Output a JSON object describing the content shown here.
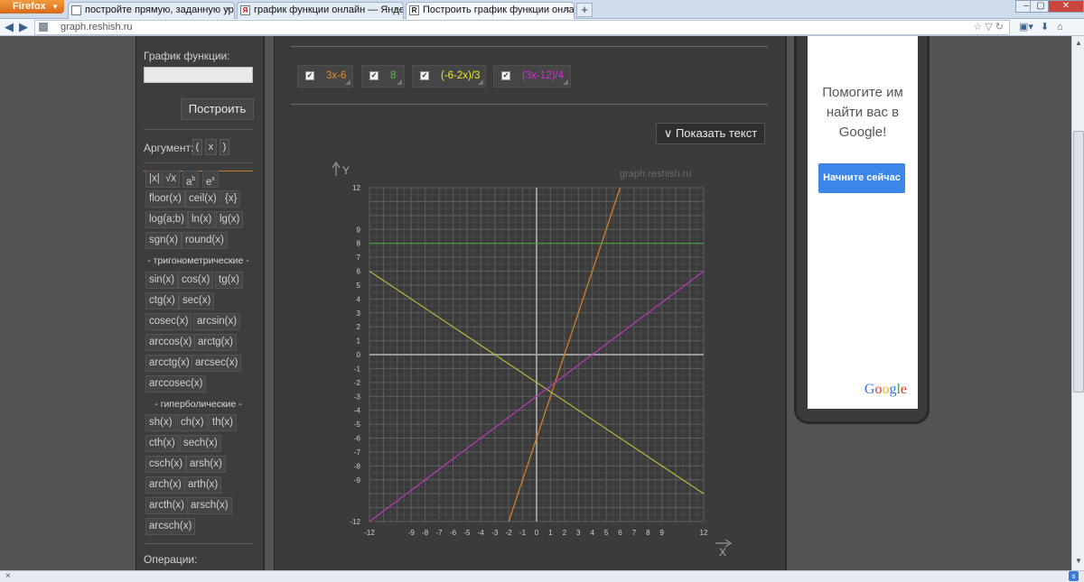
{
  "browser": {
    "app_button": "Firefox",
    "tabs": [
      {
        "label": "постройте прямую, заданную урав...",
        "icon": "page-icon"
      },
      {
        "label": "график функции онлайн — Яндекс: ...",
        "icon": "yandex-icon"
      },
      {
        "label": "Построить график функции онлайн",
        "icon": "reshish-icon"
      }
    ],
    "url": "graph.reshish.ru"
  },
  "left_panel": {
    "function_label": "График функции:",
    "function_input_value": "",
    "build_button": "Построить",
    "argument_label": "Аргумент:",
    "argument_buttons": [
      "(",
      "x",
      ")"
    ],
    "basic_buttons": [
      "|x|",
      "√x",
      "a",
      "e",
      "floor(x)",
      "ceil(x)",
      "{x}",
      "log(a;b)",
      "ln(x)",
      "lg(x)",
      "sgn(x)",
      "round(x)"
    ],
    "basic_sup": [
      "b",
      "x"
    ],
    "trig_header": "- тригонометрические -",
    "trig_buttons": [
      "sin(x)",
      "cos(x)",
      "tg(x)",
      "ctg(x)",
      "sec(x)",
      "cosec(x)",
      "arcsin(x)",
      "arccos(x)",
      "arctg(x)",
      "arcctg(x)",
      "arcsec(x)",
      "arccosec(x)"
    ],
    "hyper_header": "- гиперболические -",
    "hyper_buttons": [
      "sh(x)",
      "ch(x)",
      "th(x)",
      "cth(x)",
      "sech(x)",
      "csch(x)",
      "arsh(x)",
      "arch(x)",
      "arth(x)",
      "arcth(x)",
      "arsch(x)",
      "arcsch(x)"
    ],
    "operations_label": "Операции:"
  },
  "functions": [
    {
      "label": "3x-6",
      "color": "#e08a2c",
      "checked": true
    },
    {
      "label": "8",
      "color": "#46c33b",
      "checked": true
    },
    {
      "label": "(-6-2x)/3",
      "color": "#e8e832",
      "checked": true
    },
    {
      "label": "(3x-12)/4",
      "color": "#d62ad6",
      "checked": true
    }
  ],
  "show_text_button": "∨ Показать текст",
  "chart_data": {
    "type": "line",
    "watermark": "graph.reshish.ru",
    "xlabel": "X",
    "ylabel": "Y",
    "xlim": [
      -12,
      12
    ],
    "ylim": [
      -12,
      12
    ],
    "x_ticks": [
      -12,
      -9,
      -8,
      -7,
      -6,
      -5,
      -4,
      -3,
      -2,
      -1,
      0,
      1,
      2,
      3,
      4,
      5,
      6,
      7,
      8,
      9,
      12
    ],
    "y_ticks": [
      12,
      9,
      8,
      7,
      6,
      5,
      4,
      3,
      2,
      1,
      0,
      -1,
      -2,
      -3,
      -4,
      -5,
      -6,
      -7,
      -8,
      -9,
      -12
    ],
    "grid": true,
    "series": [
      {
        "name": "3x-6",
        "slope": 3,
        "intercept": -6,
        "color": "#d9822b"
      },
      {
        "name": "8",
        "slope": 0,
        "intercept": 8,
        "color": "#3fa53a"
      },
      {
        "name": "(-6-2x)/3",
        "slope": -0.6667,
        "intercept": -2,
        "color": "#b8b83a"
      },
      {
        "name": "(3x-12)/4",
        "slope": 0.75,
        "intercept": -3,
        "color": "#b43ab4"
      }
    ]
  },
  "ad": {
    "text": "Помогите им найти вас в Google!",
    "button": "Начните сейчас",
    "logo": "Google"
  }
}
